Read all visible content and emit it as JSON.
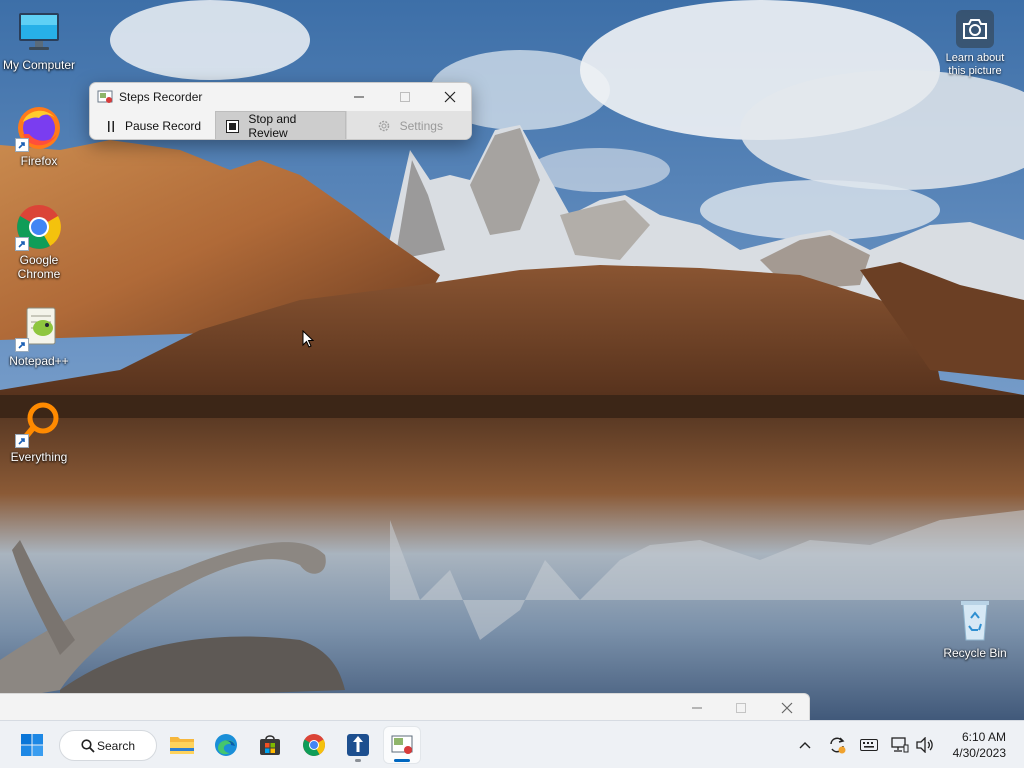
{
  "desktop": {
    "icons": [
      {
        "label": "My Computer"
      },
      {
        "label": "Firefox"
      },
      {
        "label": "Google Chrome"
      },
      {
        "label": "Notepad++"
      },
      {
        "label": "Everything"
      },
      {
        "label": "Recycle Bin"
      }
    ],
    "learn_about_picture": "Learn about this picture"
  },
  "steps_recorder": {
    "title": "Steps Recorder",
    "buttons": {
      "pause": "Pause Record",
      "stop": "Stop and Review",
      "settings": "Settings"
    }
  },
  "taskbar": {
    "search_label": "Search",
    "pinned": [
      "start-icon",
      "file-explorer-icon",
      "edge-icon",
      "microsoft-store-icon",
      "chrome-icon",
      "app-icon",
      "steps-recorder-icon"
    ],
    "clock": {
      "time": "6:10 AM",
      "date": "4/30/2023"
    }
  },
  "colors": {
    "accent": "#0067c0",
    "taskbar": "#eef1f5",
    "window": "#f3f3f3"
  }
}
